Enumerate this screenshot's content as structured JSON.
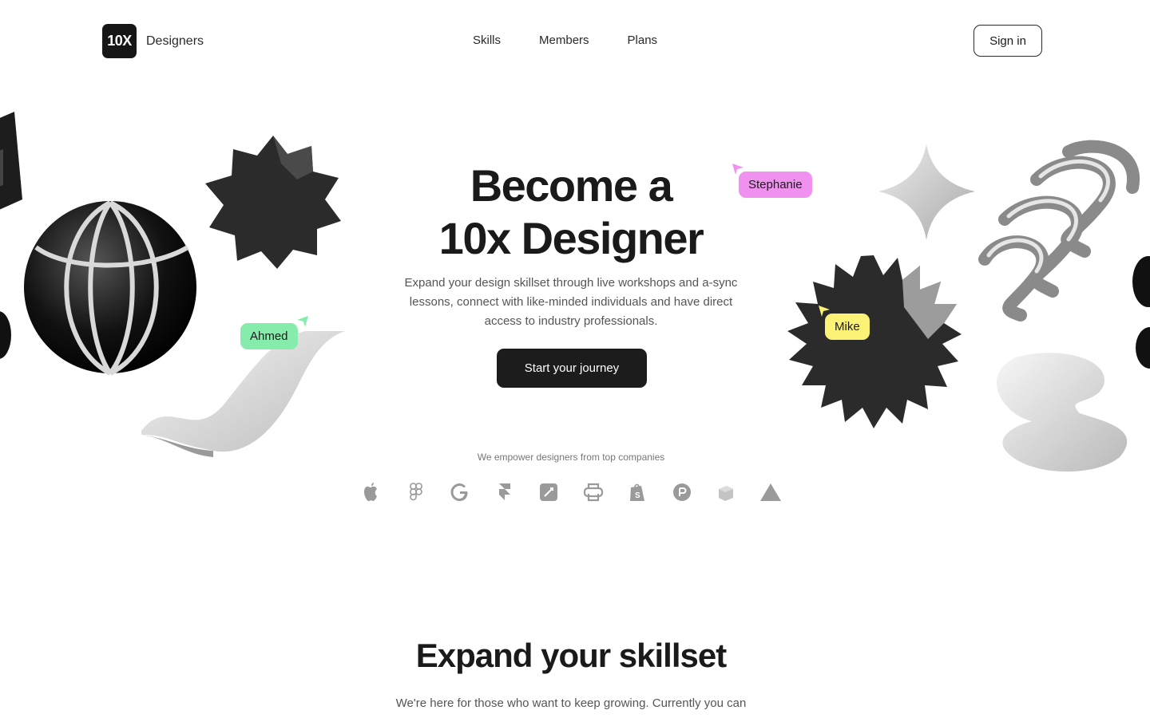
{
  "brand": {
    "mark": "10X",
    "name": "Designers"
  },
  "nav": {
    "links": [
      "Skills",
      "Members",
      "Plans"
    ],
    "signin": "Sign in"
  },
  "hero": {
    "title_line1": "Become a",
    "title_line2": "10x Designer",
    "subtitle": "Expand your design skillset through live workshops and a-sync lessons, connect with like-minded individuals and have direct access to industry professionals.",
    "cta": "Start your journey"
  },
  "tags": {
    "stephanie": "Stephanie",
    "ahmed": "Ahmed",
    "mike": "Mike"
  },
  "tag_colors": {
    "stephanie": "#f091f0",
    "ahmed": "#86ecab",
    "mike": "#fcf276"
  },
  "companies": {
    "label": "We empower designers from top companies",
    "icons": [
      "apple-icon",
      "figma-icon",
      "google-icon",
      "framer-icon",
      "notion-icon",
      "printer-icon",
      "shopify-icon",
      "producthunt-icon",
      "box-icon",
      "triangle-icon"
    ]
  },
  "section2": {
    "title": "Expand your skillset",
    "subtitle": "We're here for those who want to keep growing. Currently you can"
  }
}
